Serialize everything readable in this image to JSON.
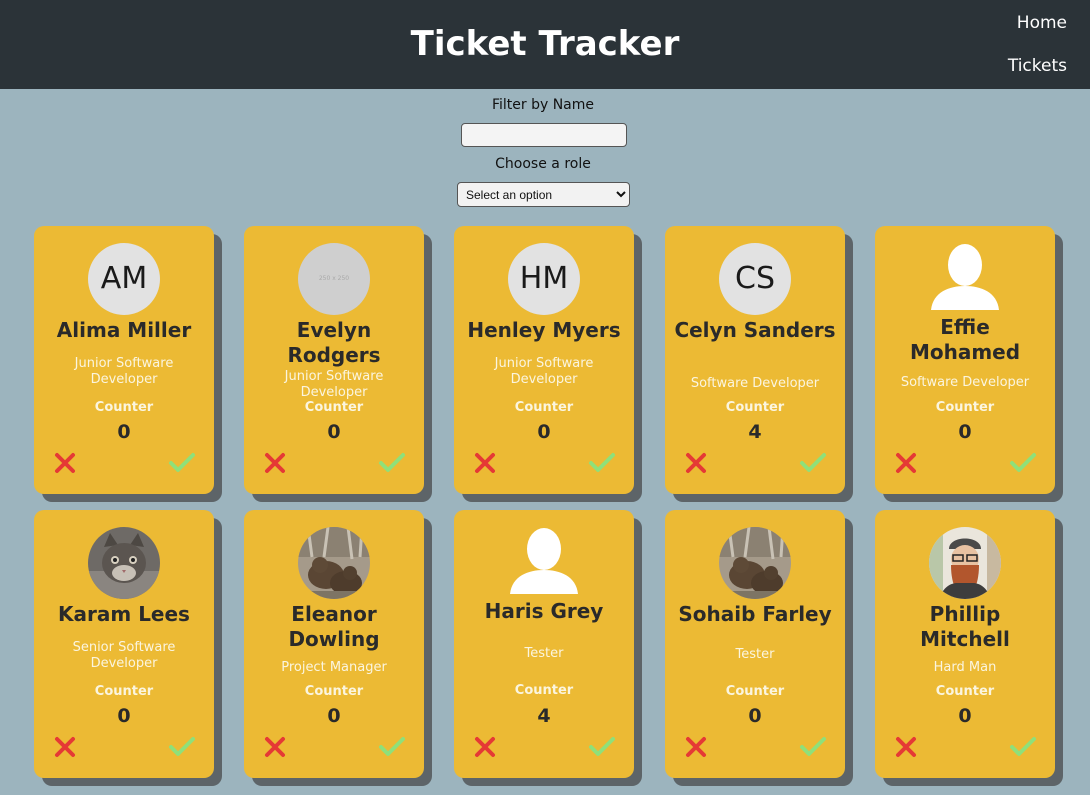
{
  "header": {
    "title": "Ticket Tracker",
    "nav": [
      {
        "label": "Home"
      },
      {
        "label": "Tickets"
      }
    ]
  },
  "filters": {
    "name_label": "Filter by Name",
    "name_value": "",
    "role_label": "Choose a role",
    "role_selected": "Select an option"
  },
  "cards_labels": {
    "counter": "Counter"
  },
  "colors": {
    "card": "#ecba34",
    "header": "#2b3338",
    "background": "#9cb4be",
    "reject": "#e53935",
    "accept": "#8fe07a"
  },
  "cards": [
    {
      "name": "Alima Miller",
      "role": "Junior Software Developer",
      "counter": "0",
      "avatar": "initials",
      "initials": "AM"
    },
    {
      "name": "Evelyn Rodgers",
      "role": "Junior Software Developer",
      "counter": "0",
      "avatar": "placeholder",
      "placeholder_text": "250 x 250"
    },
    {
      "name": "Henley Myers",
      "role": "Junior Software Developer",
      "counter": "0",
      "avatar": "initials",
      "initials": "HM"
    },
    {
      "name": "Celyn Sanders",
      "role": "Software Developer",
      "counter": "4",
      "avatar": "initials",
      "initials": "CS"
    },
    {
      "name": "Effie Mohamed",
      "role": "Software Developer",
      "counter": "0",
      "avatar": "silhouette"
    },
    {
      "name": "Karam Lees",
      "role": "Senior Software Developer",
      "counter": "0",
      "avatar": "photo-kitten"
    },
    {
      "name": "Eleanor Dowling",
      "role": "Project Manager",
      "counter": "0",
      "avatar": "photo-bears"
    },
    {
      "name": "Haris Grey",
      "role": "Tester",
      "counter": "4",
      "avatar": "silhouette"
    },
    {
      "name": "Sohaib Farley",
      "role": "Tester",
      "counter": "0",
      "avatar": "photo-bears"
    },
    {
      "name": "Phillip Mitchell",
      "role": "Hard Man",
      "counter": "0",
      "avatar": "photo-bearded-man"
    }
  ]
}
